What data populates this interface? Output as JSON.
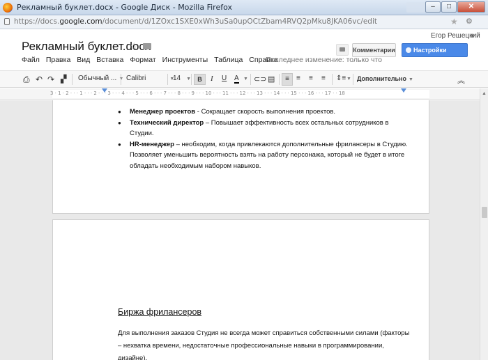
{
  "window": {
    "title": "Рекламный буклет.docx - Google Диск - Mozilla Firefox",
    "min": "–",
    "max": "□",
    "close": "✕"
  },
  "urlbar": {
    "prefix": "https://docs.",
    "host": "google.com",
    "path": "/document/d/1ZOxc1SXE0xWh3uSa0upOCtZbam4RVQ2pMku8JKA06vc/edit"
  },
  "header": {
    "doc_title": "Рекламный буклет.docx",
    "user": "Егор Решецкий",
    "comments_button": "Комментарии",
    "share_button": "Настройки доступа",
    "last_edit": "Последнее изменение: только что"
  },
  "menu": [
    "Файл",
    "Правка",
    "Вид",
    "Вставка",
    "Формат",
    "Инструменты",
    "Таблица",
    "Справка"
  ],
  "toolbar": {
    "style": "Обычный ...",
    "font": "Calibri",
    "size": "14",
    "bold": "B",
    "italic": "I",
    "underline": "U",
    "text_color": "A",
    "more": "Дополнительно"
  },
  "ruler": {
    "labels": "3 · 1 · 2 · · · 1 · · · 2 · · · 3 · · · 4 · · · 5 · · · 6 · · · 7 · · · 8 · · · 9 · · · 10 · · · 11 · · · 12 · · · 13 · · · 14 · · · 15 · · · 16 · · · 17 · · 18"
  },
  "document": {
    "bullets": [
      {
        "term": "Менеджер проектов",
        "text": " - Сокращает скорость выполнения проектов."
      },
      {
        "term": "Технический директор",
        "text": " – Повышает эффективность всех остальных сотрудников в Студии."
      },
      {
        "term": "HR-менеджер",
        "text": " – необходим, когда привлекаются дополнительные фрилансеры в Студию. Позволяет уменьшить вероятность взять на работу персонажа, который не будет в итоге обладать необходимым набором навыков."
      }
    ],
    "heading": "Биржа фрилансеров",
    "paragraph": "Для выполнения заказов Студия не всегда может справиться собственными силами (факторы – нехватка времени, недостаточные профессиональные навыки в программировании, дизайне)."
  }
}
